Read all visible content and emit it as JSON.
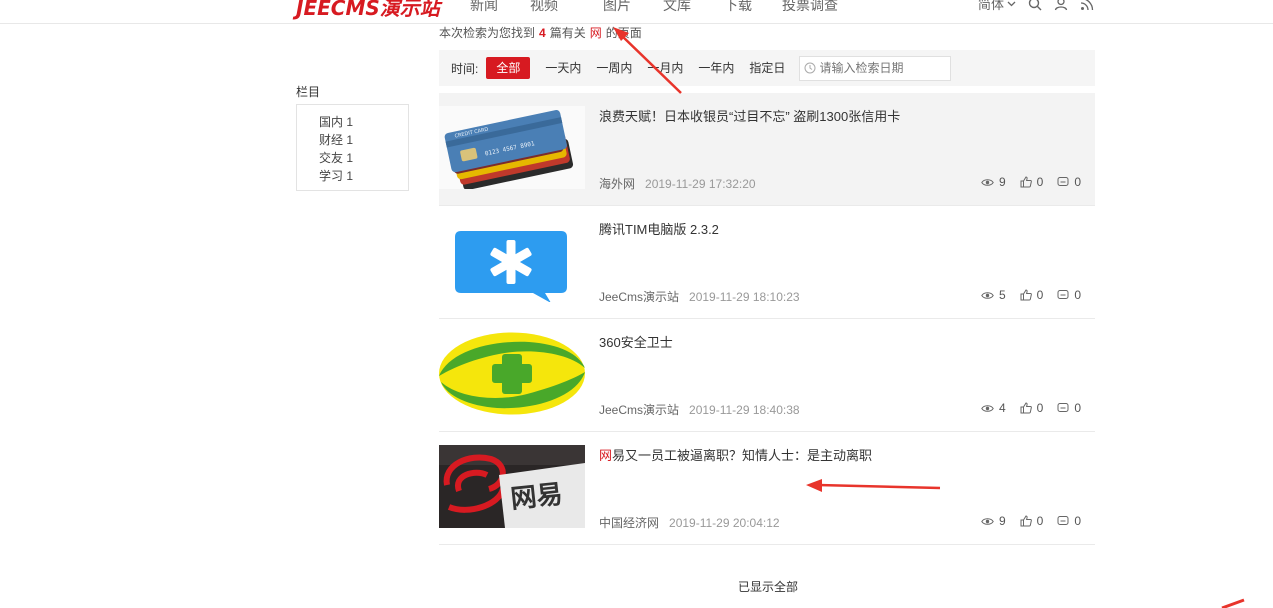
{
  "header": {
    "logo_text": "JEECMS演示站",
    "nav": [
      "新闻",
      "视频",
      "图片",
      "文库",
      "下载",
      "投票调查"
    ],
    "lang": "简体",
    "icons": [
      "chevron-down-icon",
      "search-icon",
      "user-icon",
      "rss-icon"
    ]
  },
  "summary": {
    "prefix": "本次检索为您找到",
    "count": "4",
    "middle": "篇有关",
    "keyword": "网",
    "suffix": "的页面"
  },
  "filter": {
    "label": "时间:",
    "options": [
      "全部",
      "一天内",
      "一周内",
      "一月内",
      "一年内",
      "指定日"
    ],
    "active": "全部",
    "date_placeholder": "请输入检索日期"
  },
  "sidebar": {
    "title": "栏目",
    "items": [
      "国内 1",
      "财经 1",
      "交友 1",
      "学习 1"
    ]
  },
  "results": [
    {
      "title": "浪费天赋！日本收银员“过目不忘” 盗刷1300张信用卡",
      "title_hl": "",
      "title_rest": "浪费天赋！日本收银员“过目不忘” 盗刷1300张信用卡",
      "source": "海外网",
      "date": "2019-11-29 17:32:20",
      "views": "9",
      "likes": "0",
      "comments": "0",
      "thumb": "credit-cards"
    },
    {
      "title": "腾讯TIM电脑版 2.3.2",
      "title_hl": "",
      "title_rest": "腾讯TIM电脑版 2.3.2",
      "source": "JeeCms演示站",
      "date": "2019-11-29 18:10:23",
      "views": "5",
      "likes": "0",
      "comments": "0",
      "thumb": "tim-logo"
    },
    {
      "title": "360安全卫士",
      "title_hl": "",
      "title_rest": "360安全卫士",
      "source": "JeeCms演示站",
      "date": "2019-11-29 18:40:38",
      "views": "4",
      "likes": "0",
      "comments": "0",
      "thumb": "360-logo"
    },
    {
      "title": "网易又一员工被逼离职？知情人士：是主动离职",
      "title_hl": "网",
      "title_rest": "易又一员工被逼离职？知情人士：是主动离职",
      "source": "中国经济网",
      "date": "2019-11-29 20:04:12",
      "views": "9",
      "likes": "0",
      "comments": "0",
      "thumb": "netease-sign"
    }
  ],
  "footer": {
    "all_shown": "已显示全部"
  },
  "colors": {
    "accent": "#d71a21",
    "annotation": "#e8342b"
  }
}
